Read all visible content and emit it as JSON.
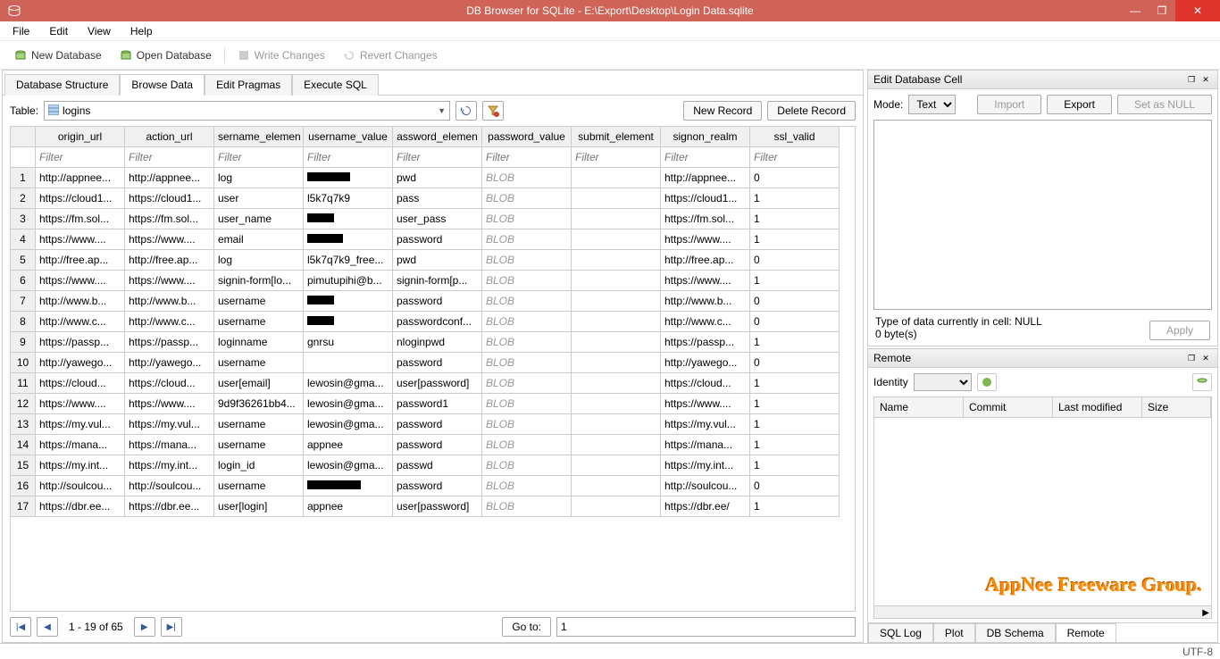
{
  "title": "DB Browser for SQLite - E:\\Export\\Desktop\\Login Data.sqlite",
  "menu": [
    "File",
    "Edit",
    "View",
    "Help"
  ],
  "toolbar": {
    "new_db": "New Database",
    "open_db": "Open Database",
    "write_changes": "Write Changes",
    "revert_changes": "Revert Changes"
  },
  "tabs": [
    "Database Structure",
    "Browse Data",
    "Edit Pragmas",
    "Execute SQL"
  ],
  "active_tab": 1,
  "table_label": "Table:",
  "table_select": "logins",
  "record_buttons": {
    "new": "New Record",
    "delete": "Delete Record"
  },
  "columns": [
    "origin_url",
    "action_url",
    "sername_elemen",
    "username_value",
    "assword_elemen",
    "password_value",
    "submit_element",
    "signon_realm",
    "ssl_valid"
  ],
  "filter_placeholder": "Filter",
  "rows": [
    {
      "n": 1,
      "c": [
        "http://appnee...",
        "http://appnee...",
        "log",
        "[REDACTED]",
        "pwd",
        "BLOB",
        "",
        "http://appnee...",
        "0"
      ]
    },
    {
      "n": 2,
      "c": [
        "https://cloud1...",
        "https://cloud1...",
        "user",
        "l5k7q7k9",
        "pass",
        "BLOB",
        "",
        "https://cloud1...",
        "1"
      ]
    },
    {
      "n": 3,
      "c": [
        "https://fm.sol...",
        "https://fm.sol...",
        "user_name",
        "[REDACTED2]",
        "user_pass",
        "BLOB",
        "",
        "https://fm.sol...",
        "1"
      ]
    },
    {
      "n": 4,
      "c": [
        "https://www....",
        "https://www....",
        "email",
        "[REDACTED3].",
        "password",
        "BLOB",
        "",
        "https://www....",
        "1"
      ]
    },
    {
      "n": 5,
      "c": [
        "http://free.ap...",
        "http://free.ap...",
        "log",
        "l5k7q7k9_free...",
        "pwd",
        "BLOB",
        "",
        "http://free.ap...",
        "0"
      ]
    },
    {
      "n": 6,
      "c": [
        "https://www....",
        "https://www....",
        "signin-form[lo...",
        "pimutupihi@b...",
        "signin-form[p...",
        "BLOB",
        "",
        "https://www....",
        "1"
      ]
    },
    {
      "n": 7,
      "c": [
        "http://www.b...",
        "http://www.b...",
        "username",
        "[REDACTED2]",
        "password",
        "BLOB",
        "",
        "http://www.b...",
        "0"
      ]
    },
    {
      "n": 8,
      "c": [
        "http://www.c...",
        "http://www.c...",
        "username",
        "[REDACTED2]",
        "passwordconf...",
        "BLOB",
        "",
        "http://www.c...",
        "0"
      ]
    },
    {
      "n": 9,
      "c": [
        "https://passp...",
        "https://passp...",
        "loginname",
        "gnrsu",
        "nloginpwd",
        "BLOB",
        "",
        "https://passp...",
        "1"
      ]
    },
    {
      "n": 10,
      "c": [
        "http://yawego...",
        "http://yawego...",
        "username",
        "",
        "password",
        "BLOB",
        "",
        "http://yawego...",
        "0"
      ]
    },
    {
      "n": 11,
      "c": [
        "https://cloud...",
        "https://cloud...",
        "user[email]",
        "lewosin@gma...",
        "user[password]",
        "BLOB",
        "",
        "https://cloud...",
        "1"
      ]
    },
    {
      "n": 12,
      "c": [
        "https://www....",
        "https://www....",
        "9d9f36261bb4...",
        "lewosin@gma...",
        "password1",
        "BLOB",
        "",
        "https://www....",
        "1"
      ]
    },
    {
      "n": 13,
      "c": [
        "https://my.vul...",
        "https://my.vul...",
        "username",
        "lewosin@gma...",
        "password",
        "BLOB",
        "",
        "https://my.vul...",
        "1"
      ]
    },
    {
      "n": 14,
      "c": [
        "https://mana...",
        "https://mana...",
        "username",
        "appnee",
        "password",
        "BLOB",
        "",
        "https://mana...",
        "1"
      ]
    },
    {
      "n": 15,
      "c": [
        "https://my.int...",
        "https://my.int...",
        "login_id",
        "lewosin@gma...",
        "passwd",
        "BLOB",
        "",
        "https://my.int...",
        "1"
      ]
    },
    {
      "n": 16,
      "c": [
        "http://soulcou...",
        "http://soulcou...",
        "username",
        "[REDACTED4]",
        "password",
        "BLOB",
        "",
        "http://soulcou...",
        "0"
      ]
    },
    {
      "n": 17,
      "c": [
        "https://dbr.ee...",
        "https://dbr.ee...",
        "user[login]",
        "appnee",
        "user[password]",
        "BLOB",
        "",
        "https://dbr.ee/",
        "1"
      ]
    }
  ],
  "pager": {
    "range": "1 - 19 of 65",
    "goto": "Go to:",
    "value": "1"
  },
  "cell_panel": {
    "title": "Edit Database Cell",
    "mode_label": "Mode:",
    "mode": "Text",
    "import": "Import",
    "export": "Export",
    "null": "Set as NULL",
    "type_info": "Type of data currently in cell: NULL",
    "size_info": "0 byte(s)",
    "apply": "Apply"
  },
  "remote_panel": {
    "title": "Remote",
    "identity": "Identity",
    "cols": [
      "Name",
      "Commit",
      "Last modified",
      "Size"
    ]
  },
  "btabs": [
    "SQL Log",
    "Plot",
    "DB Schema",
    "Remote"
  ],
  "active_btab": 3,
  "status": "UTF-8",
  "watermark": "AppNee Freeware Group."
}
